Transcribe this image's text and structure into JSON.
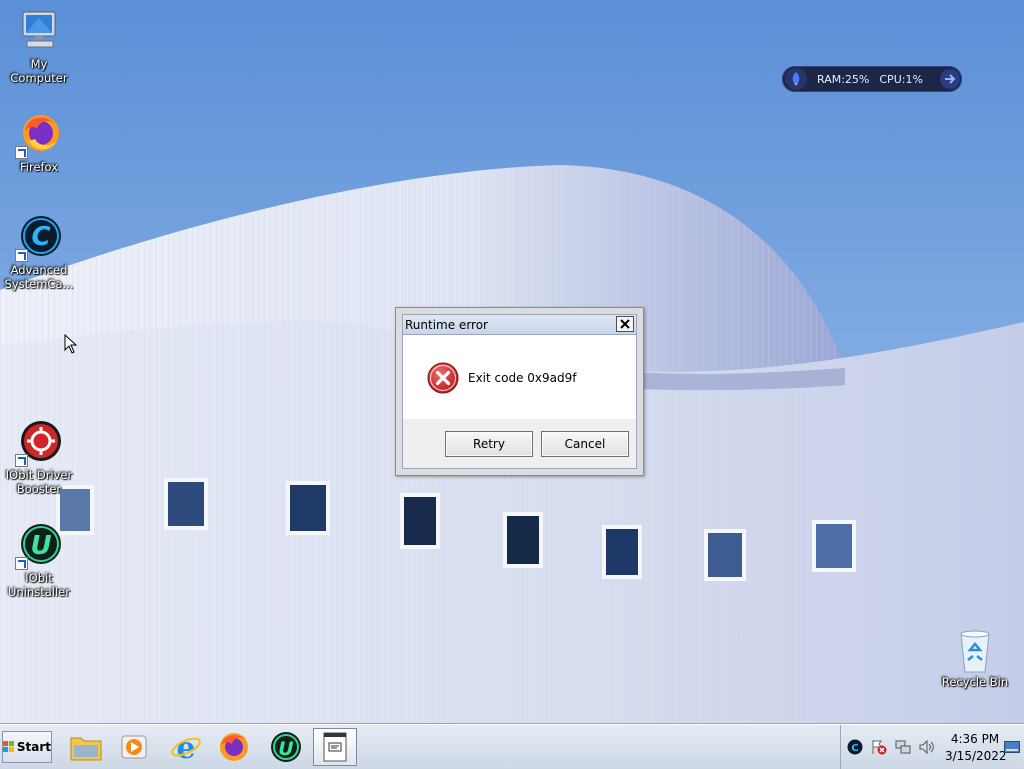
{
  "desktop": {
    "icons": [
      {
        "label": "My Computer",
        "icon": "computer-icon"
      },
      {
        "label": "Firefox",
        "icon": "firefox-icon"
      },
      {
        "label": "Advanced SystemCa...",
        "icon": "advanced-systemcare-icon"
      },
      {
        "label": "IObit Driver Booster",
        "icon": "driver-booster-icon"
      },
      {
        "label": "IObit Uninstaller",
        "icon": "iobit-uninstaller-icon"
      },
      {
        "label": "Recycle Bin",
        "icon": "recycle-bin-icon"
      }
    ]
  },
  "gadget": {
    "ram": "RAM:25%",
    "cpu": "CPU:1%"
  },
  "dialog": {
    "title": "Runtime error",
    "message": "Exit code 0x9ad9f",
    "retry_label": "Retry",
    "cancel_label": "Cancel"
  },
  "taskbar": {
    "start_label": "Start",
    "pinned": [
      "file-explorer-icon",
      "media-player-icon",
      "internet-explorer-icon",
      "firefox-icon",
      "iobit-uninstaller-icon",
      "document-window-icon"
    ],
    "clock_time": "4:36 PM",
    "clock_date": "3/15/2022"
  },
  "colors": {
    "error_red": "#d32f2f",
    "sky": "#6f9fdc",
    "taskbar": "#dbe3ee"
  }
}
